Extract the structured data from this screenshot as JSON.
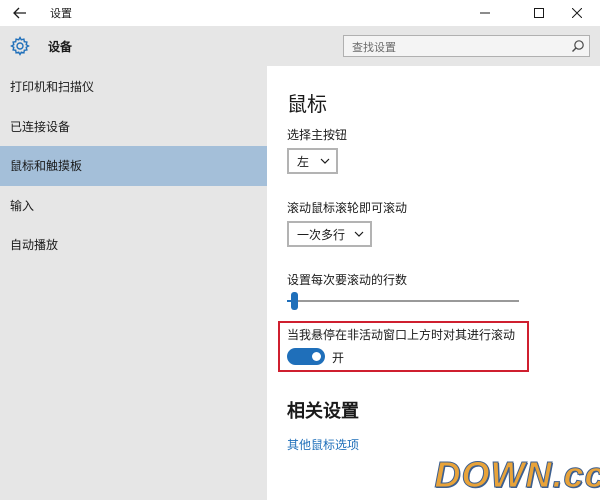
{
  "window": {
    "title": "设置",
    "back_icon": "arrow-left-icon",
    "minimize_icon": "minimize-icon",
    "maximize_icon": "maximize-icon",
    "close_icon": "close-icon"
  },
  "sidebar": {
    "header_icon": "gear-icon",
    "header_title": "设备",
    "items": [
      {
        "label": "打印机和扫描仪",
        "active": false
      },
      {
        "label": "已连接设备",
        "active": false
      },
      {
        "label": "鼠标和触摸板",
        "active": true
      },
      {
        "label": "输入",
        "active": false
      },
      {
        "label": "自动播放",
        "active": false
      }
    ]
  },
  "search": {
    "placeholder": "查找设置",
    "icon": "search-icon"
  },
  "main": {
    "section_title": "鼠标",
    "primary_button": {
      "label": "选择主按钮",
      "value": "左"
    },
    "scroll_wheel": {
      "label": "滚动鼠标滚轮即可滚动",
      "value": "一次多行"
    },
    "scroll_lines": {
      "label": "设置每次要滚动的行数",
      "level": 0.03
    },
    "inactive_scroll": {
      "label": "当我悬停在非活动窗口上方时对其进行滚动",
      "toggle_state": "开",
      "on": true
    },
    "related_title": "相关设置",
    "related_link": "其他鼠标选项"
  },
  "watermark": {
    "text": "DOWN.cc"
  },
  "colors": {
    "accent": "#1f6fba",
    "sidebar_bg": "#e6e6e6",
    "sidebar_active": "#a4bfd9",
    "highlight_border": "#cf1f2f"
  }
}
